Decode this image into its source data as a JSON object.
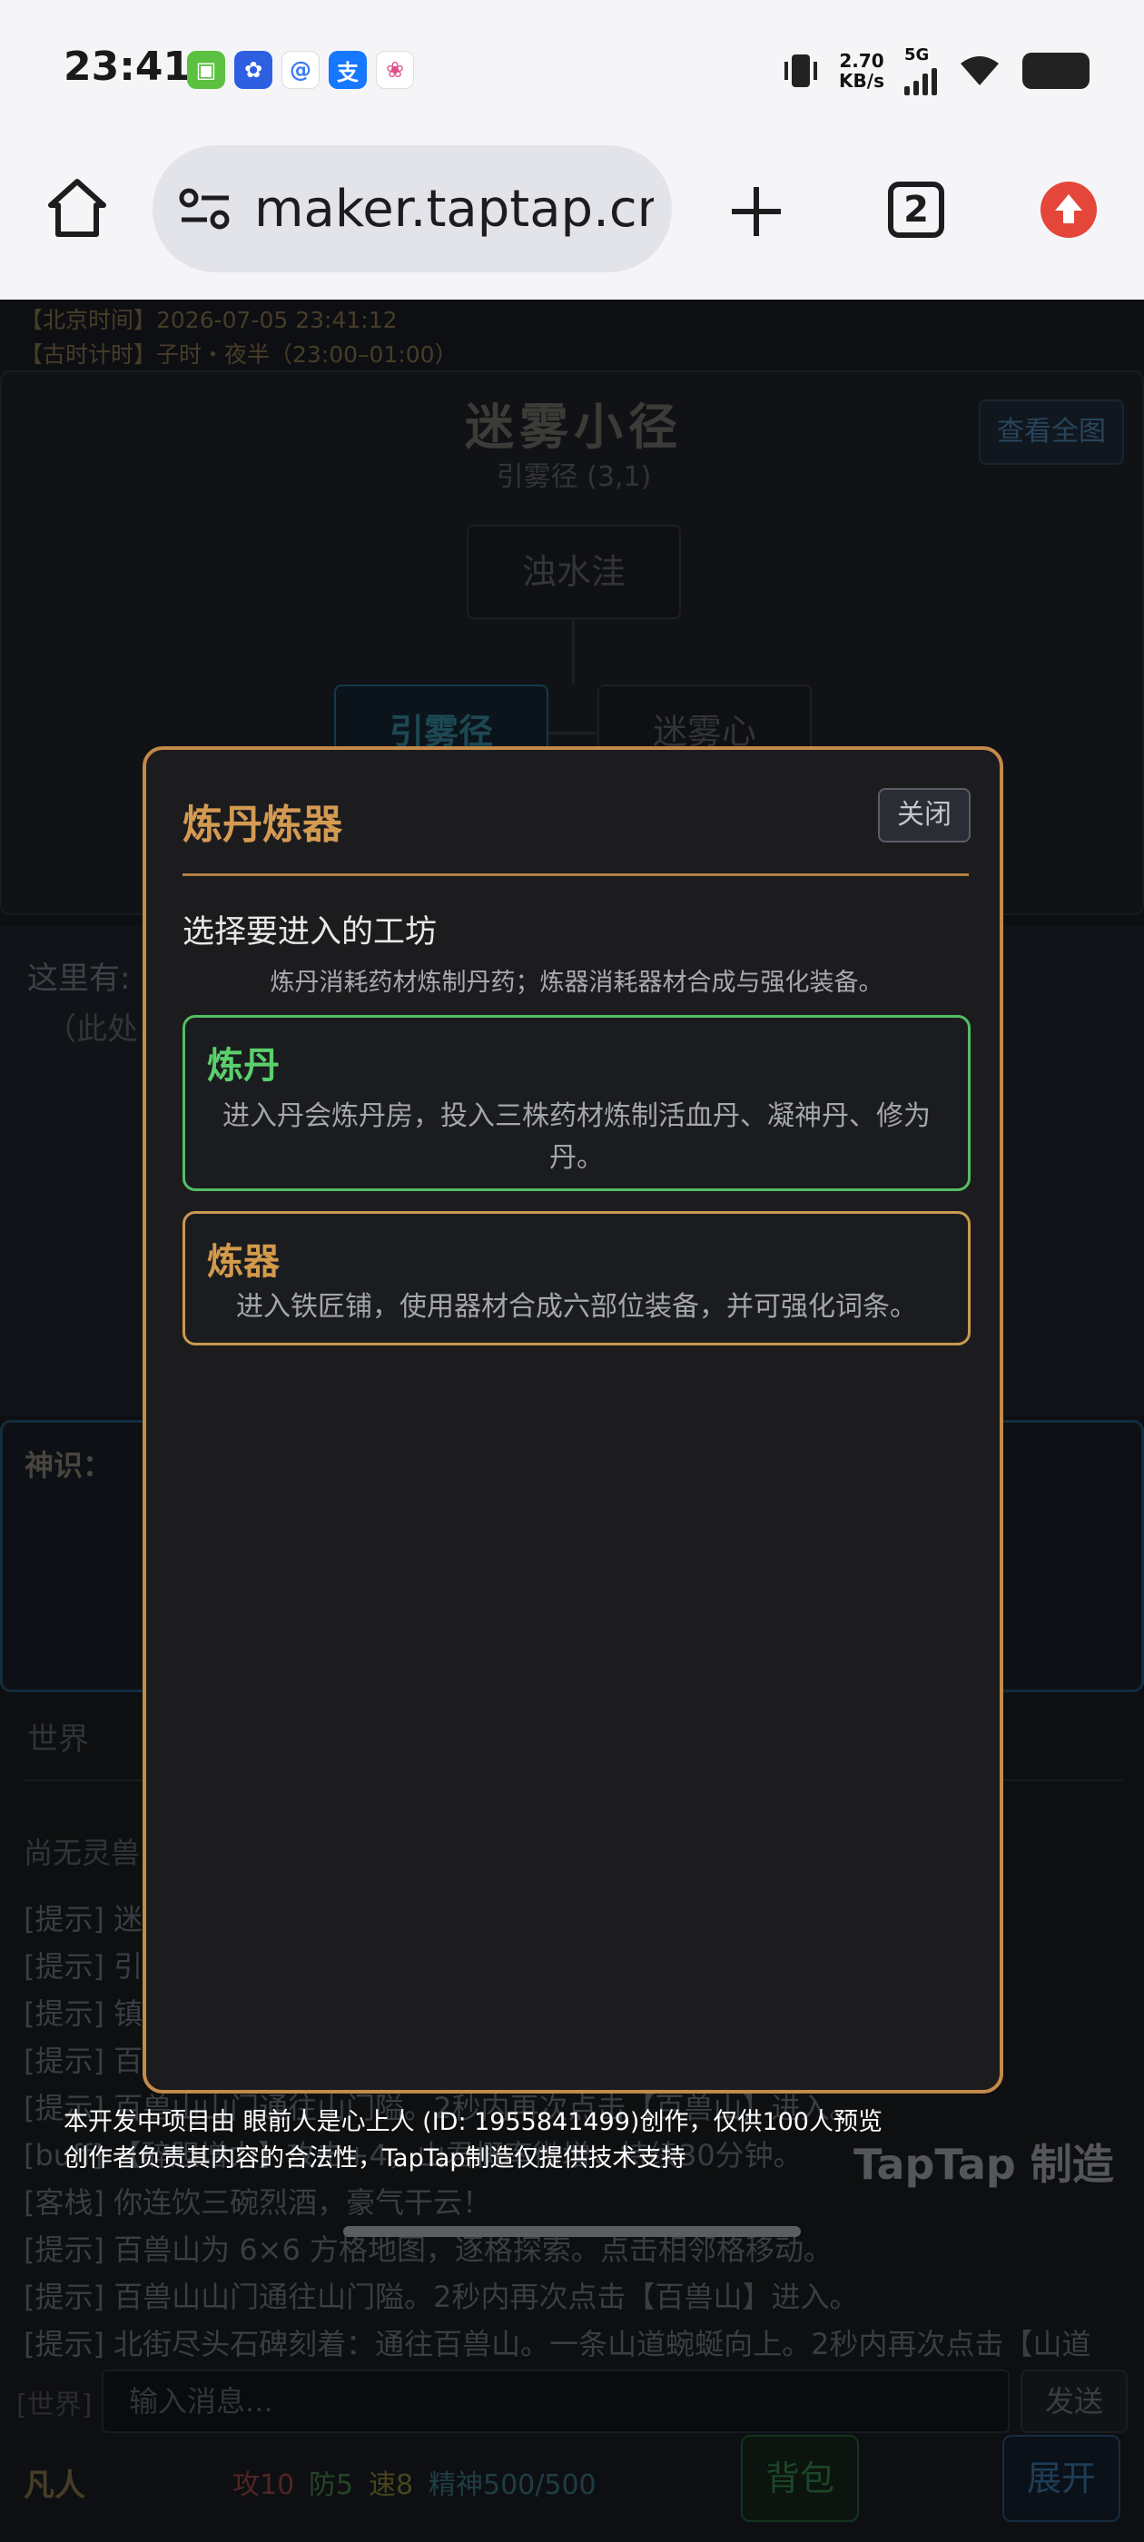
{
  "status_bar": {
    "time": "23:41",
    "net_speed_value": "2.70",
    "net_speed_unit": "KB/s",
    "network": "5G"
  },
  "browser": {
    "url": "maker.taptap.cn/s",
    "tab_count": "2"
  },
  "game": {
    "beijing_time": "【北京时间】2026-07-05 23:41:12",
    "ancient_time": "【古时计时】子时・夜半（23:00–01:00）",
    "map": {
      "title": "迷雾小径",
      "subtitle": "引雾径 (3,1)",
      "view_all": "查看全图",
      "nodes": {
        "north": "浊水洼",
        "current": "引雾径",
        "east": "迷雾心"
      }
    },
    "scene": {
      "here_label": "这里有:",
      "here_note": "（此处"
    },
    "sense_label": "神识：",
    "chat": {
      "tab_world": "世界",
      "empty_text": "尚无灵兽",
      "logs": [
        "[提示] 迷",
        "[提示] 引",
        "[提示] 镇",
        "[提示] 百",
        "[提示] 百兽山山门通往山门隘。2秒内再次点击【百兽山】进入。",
        "[buff] 【醉胆增力】攻击+4，山君概率微增，持续30分钟。",
        "[客栈] 你连饮三碗烈酒，豪气干云！",
        "[提示] 百兽山为 6×6 方格地图，逐格探索。点击相邻格移动。",
        "[提示] 百兽山山门通往山门隘。2秒内再次点击【百兽山】进入。",
        "[提示] 北街尽头石碑刻着：通往百兽山。一条山道蜿蜒向上。2秒内再次点击【山道"
      ]
    },
    "input": {
      "world_tag": "[世界]",
      "placeholder": "输入消息...",
      "send": "发送"
    },
    "stats": {
      "rank": "凡人",
      "atk": "攻10",
      "def": "防5",
      "spd": "速8",
      "spirit": "精神500/500",
      "bag": "背包",
      "expand": "展开"
    },
    "disclaimer": [
      "本开发中项目由 眼前人是心上人 (ID: 1955841499)创作，仅供100人预览",
      "创作者负责其内容的合法性，TapTap制造仅提供技术支持"
    ],
    "watermark": "TapTap 制造"
  },
  "modal": {
    "title": "炼丹炼器",
    "close": "关闭",
    "subtitle": "选择要进入的工坊",
    "description": "炼丹消耗药材炼制丹药；炼器消耗器材合成与强化装备。",
    "options": [
      {
        "title": "炼丹",
        "desc": "进入丹会炼丹房，投入三株药材炼制活血丹、凝神丹、修为丹。"
      },
      {
        "title": "炼器",
        "desc": "进入铁匠铺，使用器材合成六部位装备，并可强化词条。"
      }
    ]
  },
  "colors": {
    "modal_border": "#c38a4a",
    "alchemy_accent": "#5bcf6c",
    "forge_accent": "#d39a4c"
  }
}
